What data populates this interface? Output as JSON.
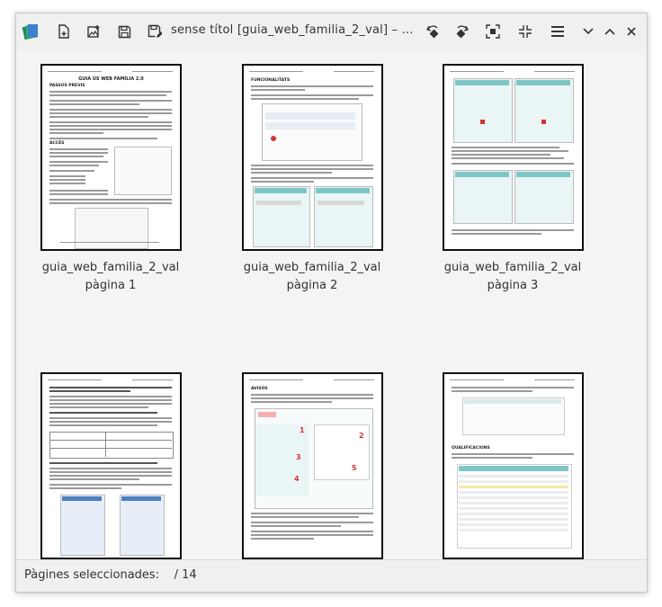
{
  "window": {
    "title": "sense títol [guia_web_familia_2_val] – ..."
  },
  "toolbar": {
    "icons": [
      "app-logo-icon",
      "new-document-icon",
      "insert-image-icon",
      "save-icon",
      "save-as-icon",
      "rotate-left-icon",
      "rotate-right-icon",
      "zoom-fit-icon",
      "zoom-shrink-icon",
      "menu-icon",
      "chevron-down-icon",
      "chevron-up-icon",
      "close-icon"
    ]
  },
  "pages": [
    {
      "name": "guia_web_familia_2_val",
      "label": "pàgina 1"
    },
    {
      "name": "guia_web_familia_2_val",
      "label": "pàgina 2"
    },
    {
      "name": "guia_web_familia_2_val",
      "label": "pàgina 3"
    },
    {
      "name": "",
      "label": ""
    },
    {
      "name": "",
      "label": ""
    },
    {
      "name": "",
      "label": ""
    }
  ],
  "page_text": {
    "p1_title": "GUIA ÚS WEB FAMÍLIA 2.0",
    "p1_heading": "PASSOS PREVIS",
    "p1_heading2": "ACCÉS",
    "p2_heading": "FUNCIONALITATS",
    "p5_heading": "AVISOS",
    "p6_heading": "QUALIFICACIONS"
  },
  "status": {
    "label": "Pàgines seleccionades:",
    "value": "/ 14"
  },
  "colors": {
    "window_bg": "#f0f0f0",
    "accent_teal": "#7fc6c6",
    "accent_red": "#d33333"
  }
}
